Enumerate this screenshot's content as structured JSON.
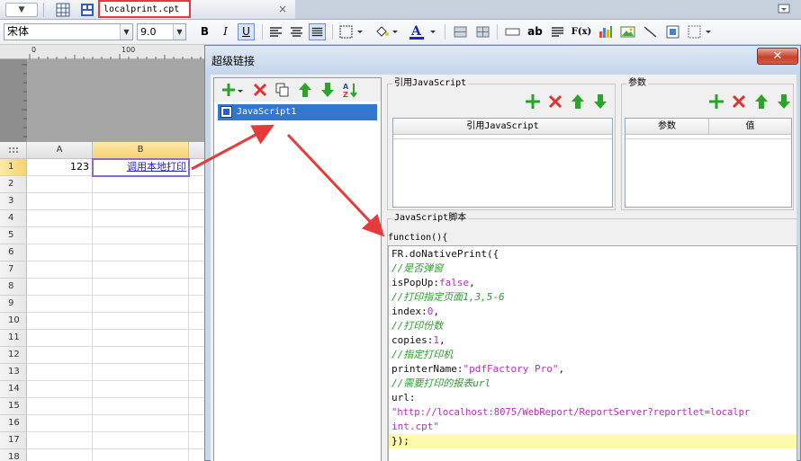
{
  "tab": {
    "filename": "localprint.cpt",
    "close": "×"
  },
  "toolbar": {
    "font_name": "宋体",
    "font_size": "9.0",
    "bold": "B",
    "italic": "I",
    "underline": "U",
    "text_btn": "ab",
    "formula_btn": "F(x)"
  },
  "ruler": {
    "tick0": "0",
    "tick100": "100"
  },
  "sheet": {
    "columns": [
      "A",
      "B"
    ],
    "rows": [
      "1",
      "2",
      "3",
      "4",
      "5",
      "6",
      "7",
      "8",
      "9",
      "10",
      "11",
      "12",
      "13",
      "14",
      "15",
      "16",
      "17",
      "18"
    ],
    "cell_a1": "123",
    "cell_b1": "调用本地打印"
  },
  "dialog": {
    "title": "超级链接",
    "close": "✕",
    "list_item": "JavaScript1",
    "ref_group_label": "引用JavaScript",
    "ref_table_header": "引用JavaScript",
    "param_group_label": "参数",
    "param_col_name": "参数",
    "param_col_value": "值",
    "script_group_label": "JavaScript脚本",
    "function_header": "function(){"
  },
  "code": {
    "l1": "FR.doNativePrint({",
    "l2": "//是否弹窗",
    "l3_k": "isPopUp:",
    "l3_v": "false",
    "l3_e": ",",
    "l4": "//打印指定页面1,3,5-6",
    "l5_k": "index:",
    "l5_v": "0",
    "l5_e": ",",
    "l6": "//打印份数",
    "l7_k": "copies:",
    "l7_v": "1",
    "l7_e": ",",
    "l8": "//指定打印机",
    "l9_k": "printerName:",
    "l9_v": "\"pdfFactory Pro\"",
    "l9_e": ",",
    "l10": "//需要打印的报表url",
    "l11": "url:",
    "l12": "\"http://localhost:8075/WebReport/ReportServer?reportlet=localpr",
    "l13_v": "int.cpt\"",
    "l14": "});"
  },
  "colors": {
    "annotation": "#e53b3b",
    "selection": "#3278d2",
    "comment": "#2e9b2e",
    "keyword": "#b72fb7",
    "highlight": "#fdfaae"
  }
}
